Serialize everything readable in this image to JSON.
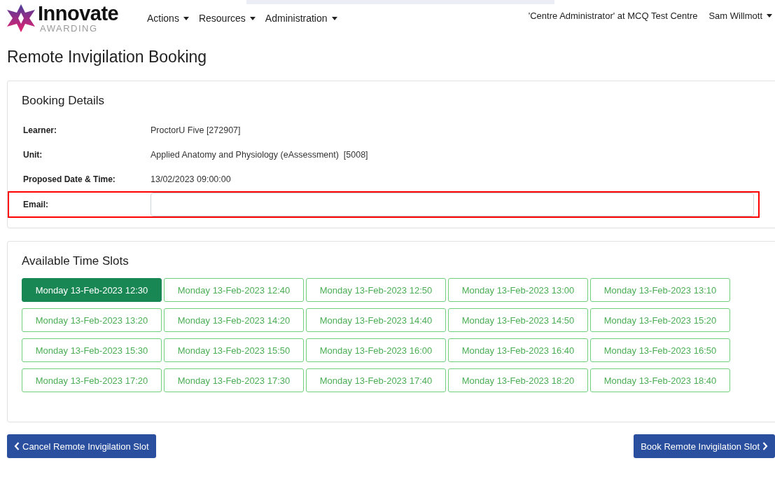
{
  "logo": {
    "name": "Innovate",
    "tagline": "AWARDING"
  },
  "nav": [
    {
      "label": "Actions"
    },
    {
      "label": "Resources"
    },
    {
      "label": "Administration"
    }
  ],
  "role": "'Centre Administrator' at MCQ Test Centre",
  "user": {
    "label": "Sam Willmott"
  },
  "page_title": "Remote Invigilation Booking",
  "booking_details": {
    "heading": "Booking Details",
    "rows": [
      {
        "kind": "text",
        "label": "Learner:",
        "value": "ProctorU Five [272907]",
        "highlighted": false
      },
      {
        "kind": "text",
        "label": "Unit:",
        "value": "Applied Anatomy and Physiology (eAssessment)  [5008]",
        "highlighted": false
      },
      {
        "kind": "text",
        "label": "Proposed Date & Time:",
        "value": "13/02/2023 09:00:00",
        "highlighted": false
      },
      {
        "kind": "input",
        "label": "Email:",
        "highlighted": true
      }
    ]
  },
  "time_slots": {
    "heading": "Available Time Slots",
    "slots": [
      {
        "label": "Monday 13-Feb-2023 12:30",
        "selected": true
      },
      {
        "label": "Monday 13-Feb-2023 12:40",
        "selected": false
      },
      {
        "label": "Monday 13-Feb-2023 12:50",
        "selected": false
      },
      {
        "label": "Monday 13-Feb-2023 13:00",
        "selected": false
      },
      {
        "label": "Monday 13-Feb-2023 13:10",
        "selected": false
      },
      {
        "label": "Monday 13-Feb-2023 13:20",
        "selected": false
      },
      {
        "label": "Monday 13-Feb-2023 14:20",
        "selected": false
      },
      {
        "label": "Monday 13-Feb-2023 14:40",
        "selected": false
      },
      {
        "label": "Monday 13-Feb-2023 14:50",
        "selected": false
      },
      {
        "label": "Monday 13-Feb-2023 15:20",
        "selected": false
      },
      {
        "label": "Monday 13-Feb-2023 15:30",
        "selected": false
      },
      {
        "label": "Monday 13-Feb-2023 15:50",
        "selected": false
      },
      {
        "label": "Monday 13-Feb-2023 16:00",
        "selected": false
      },
      {
        "label": "Monday 13-Feb-2023 16:40",
        "selected": false
      },
      {
        "label": "Monday 13-Feb-2023 16:50",
        "selected": false
      },
      {
        "label": "Monday 13-Feb-2023 17:20",
        "selected": false
      },
      {
        "label": "Monday 13-Feb-2023 17:30",
        "selected": false
      },
      {
        "label": "Monday 13-Feb-2023 17:40",
        "selected": false
      },
      {
        "label": "Monday 13-Feb-2023 18:20",
        "selected": false
      },
      {
        "label": "Monday 13-Feb-2023 18:40",
        "selected": false
      }
    ]
  },
  "actions": [
    {
      "kind": "back",
      "label": "Cancel Remote Invigilation Slot"
    },
    {
      "kind": "forward",
      "label": "Book Remote Invigilation Slot"
    }
  ]
}
